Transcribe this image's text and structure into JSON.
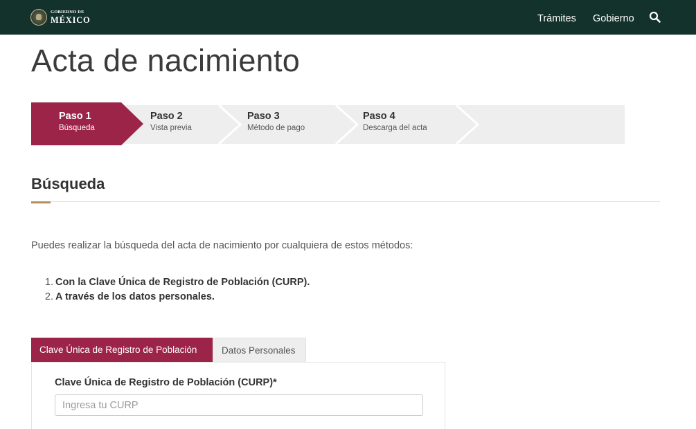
{
  "header": {
    "logo_small": "GOBIERNO DE",
    "logo_big": "MÉXICO",
    "nav": [
      {
        "label": "Trámites"
      },
      {
        "label": "Gobierno"
      }
    ],
    "search_icon": "search-icon"
  },
  "page": {
    "title": "Acta de nacimiento"
  },
  "stepper": {
    "steps": [
      {
        "num": "Paso 1",
        "desc": "Búsqueda",
        "active": true
      },
      {
        "num": "Paso 2",
        "desc": "Vista previa",
        "active": false
      },
      {
        "num": "Paso 3",
        "desc": "Método de pago",
        "active": false
      },
      {
        "num": "Paso 4",
        "desc": "Descarga del acta",
        "active": false
      }
    ]
  },
  "section": {
    "title": "Búsqueda",
    "intro": "Puedes realizar la búsqueda del acta de nacimiento por cualquiera de estos métodos:",
    "methods": [
      {
        "num": "1.",
        "text": "Con la Clave Única de Registro de Población (CURP)."
      },
      {
        "num": "2.",
        "text": "A través de los datos personales."
      }
    ]
  },
  "tabs": [
    {
      "label": "Clave Única de Registro de Población",
      "active": true
    },
    {
      "label": "Datos Personales",
      "active": false
    }
  ],
  "form": {
    "curp_label": "Clave Única de Registro de Población (CURP)*",
    "curp_value": "",
    "curp_placeholder": "Ingresa tu CURP"
  },
  "colors": {
    "navbar": "#13322b",
    "accent": "#9d2449",
    "gold": "#b38e5d",
    "step_inactive": "#eeeeee"
  }
}
